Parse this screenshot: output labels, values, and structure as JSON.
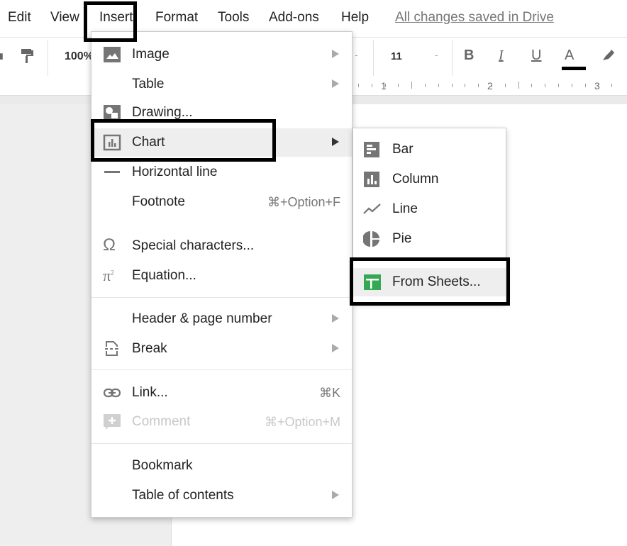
{
  "menubar": {
    "items": [
      "Edit",
      "View",
      "Insert",
      "Format",
      "Tools",
      "Add-ons",
      "Help"
    ],
    "save_status": "All changes saved in Drive"
  },
  "toolbar": {
    "zoom": "100%",
    "font_size": "11",
    "bold": "B",
    "italic": "I",
    "underline": "U",
    "text_color": "A"
  },
  "ruler": {
    "labels": [
      "1",
      "2",
      "3"
    ]
  },
  "insert_menu": {
    "items": [
      {
        "label": "Image",
        "icon": "image-icon",
        "submenu": true
      },
      {
        "label": "Table",
        "submenu": true
      },
      {
        "label": "Drawing...",
        "icon": "drawing-icon"
      },
      {
        "label": "Chart",
        "icon": "chart-icon",
        "submenu": true,
        "highlighted": true
      },
      {
        "label": "Horizontal line",
        "icon": "horizontal-line-icon"
      },
      {
        "label": "Footnote",
        "shortcut": "⌘+Option+F"
      },
      {
        "label": "Special characters...",
        "icon": "omega-icon"
      },
      {
        "label": "Equation...",
        "icon": "pi-icon"
      },
      {
        "label": "Header & page number",
        "submenu": true
      },
      {
        "label": "Break",
        "icon": "break-icon",
        "submenu": true
      },
      {
        "label": "Link...",
        "icon": "link-icon",
        "shortcut": "⌘K"
      },
      {
        "label": "Comment",
        "icon": "comment-icon",
        "shortcut": "⌘+Option+M",
        "disabled": true
      },
      {
        "label": "Bookmark"
      },
      {
        "label": "Table of contents",
        "submenu": true
      }
    ]
  },
  "chart_submenu": {
    "items": [
      {
        "label": "Bar",
        "icon": "bar-chart-icon"
      },
      {
        "label": "Column",
        "icon": "column-chart-icon"
      },
      {
        "label": "Line",
        "icon": "line-chart-icon"
      },
      {
        "label": "Pie",
        "icon": "pie-chart-icon"
      },
      {
        "label": "From Sheets...",
        "icon": "sheets-icon",
        "highlighted": true
      }
    ]
  },
  "colors": {
    "sheets_green": "#34a853",
    "icon_grey": "#757575",
    "highlight_border": "#000000"
  }
}
